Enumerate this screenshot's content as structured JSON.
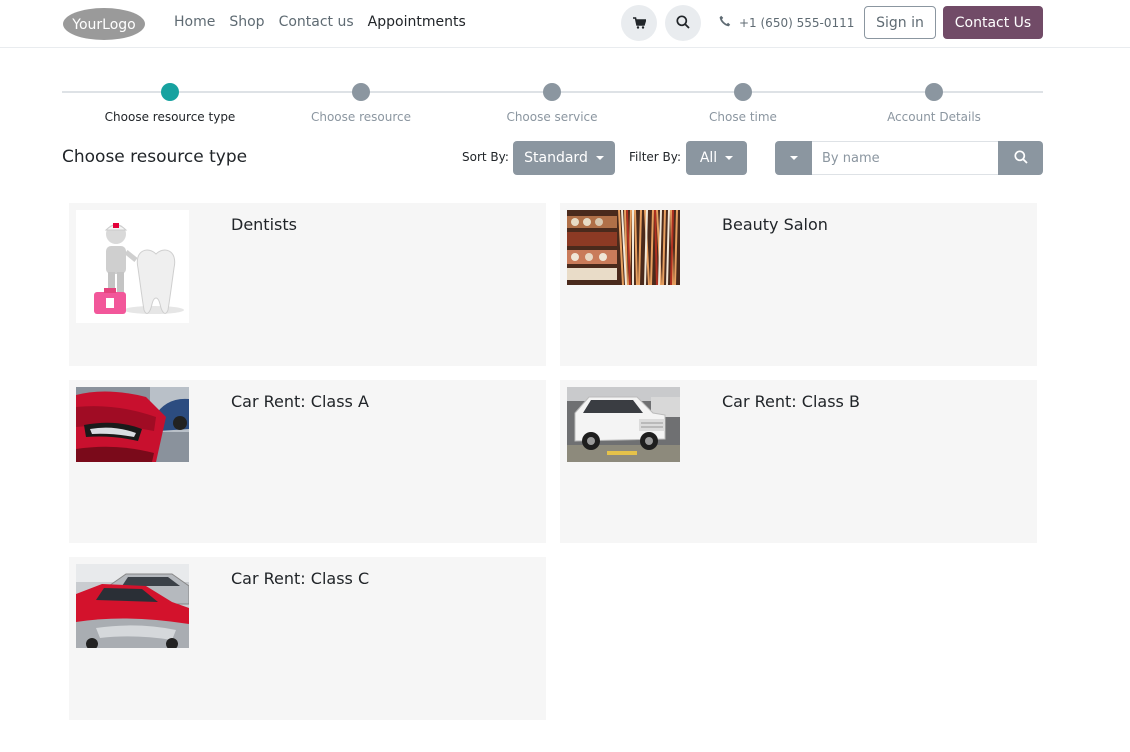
{
  "header": {
    "logo_text": "YourLogo",
    "nav": [
      "Home",
      "Shop",
      "Contact us",
      "Appointments"
    ],
    "active_nav": "Appointments",
    "phone": "+1 (650) 555-0111",
    "signin_label": "Sign in",
    "contact_label": "Contact Us"
  },
  "steps": [
    {
      "label": "Choose resource type",
      "active": true
    },
    {
      "label": "Choose resource",
      "active": false
    },
    {
      "label": "Choose service",
      "active": false
    },
    {
      "label": "Chose time",
      "active": false
    },
    {
      "label": "Account Details",
      "active": false
    }
  ],
  "toolbar": {
    "title": "Choose resource type",
    "sort_label": "Sort By:",
    "sort_value": "Standard",
    "filter_label": "Filter By:",
    "filter_value": "All",
    "search_placeholder": "By name"
  },
  "cards": [
    {
      "name": "Dentists",
      "image": "dentist-figure-with-tooth"
    },
    {
      "name": "Beauty Salon",
      "image": "salon-products-shelf"
    },
    {
      "name": "Car Rent: Class A",
      "image": "red-car-headlight"
    },
    {
      "name": "Car Rent: Class B",
      "image": "white-suv"
    },
    {
      "name": "Car Rent: Class C",
      "image": "parked-cars"
    }
  ],
  "colors": {
    "accent": "#714b67",
    "step_active": "#17a2a0",
    "step_inactive": "#8b96a0",
    "button_gray": "#8b96a0",
    "card_bg": "#f6f6f6"
  }
}
